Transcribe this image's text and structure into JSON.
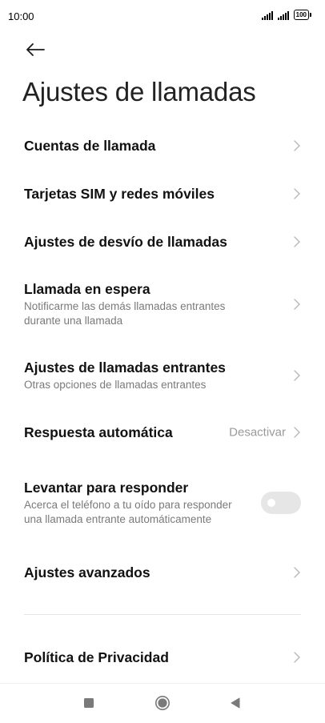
{
  "status_bar": {
    "time": "10:00",
    "battery": "100",
    "icons": [
      "signal-icon",
      "signal-icon",
      "battery-icon"
    ]
  },
  "header": {
    "back_icon": "arrow-left-icon",
    "title": "Ajustes de llamadas"
  },
  "settings": {
    "items": [
      {
        "label": "Cuentas de llamada",
        "icon": "chevron-right-icon"
      },
      {
        "label": "Tarjetas SIM y redes móviles",
        "icon": "chevron-right-icon"
      },
      {
        "label": "Ajustes de desvío de llamadas",
        "icon": "chevron-right-icon"
      },
      {
        "label": "Llamada en espera",
        "subtitle": "Notificarme las demás llamadas entrantes durante una llamada",
        "icon": "chevron-right-icon"
      },
      {
        "label": "Ajustes de llamadas entrantes",
        "subtitle": "Otras opciones de llamadas entrantes",
        "icon": "chevron-right-icon"
      },
      {
        "label": "Respuesta automática",
        "value": "Desactivar",
        "icon": "chevron-right-icon"
      },
      {
        "label": "Levantar para responder",
        "subtitle": "Acerca el teléfono a tu oído para responder una llamada entrante automáticamente",
        "toggle_on": false
      },
      {
        "label": "Ajustes avanzados",
        "icon": "chevron-right-icon"
      }
    ],
    "footer_items": [
      {
        "label": "Política de Privacidad",
        "icon": "chevron-right-icon"
      }
    ]
  },
  "nav_bar": {
    "icons": [
      "square-icon",
      "circle-icon",
      "triangle-left-icon"
    ]
  },
  "colors": {
    "background": "#ffffff",
    "text_primary": "#111111",
    "text_secondary": "#7a7a7a",
    "toggle_off": "#e6e6e6",
    "chevron": "#b8b8b8"
  }
}
